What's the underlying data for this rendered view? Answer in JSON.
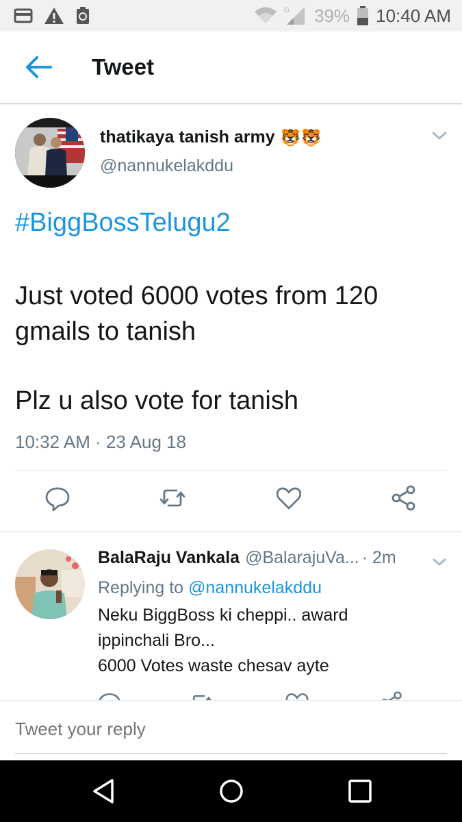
{
  "status_bar": {
    "battery": "39%",
    "time": "10:40 AM",
    "icons": [
      "card-icon",
      "warning-icon",
      "recycle-icon",
      "wifi-icon",
      "signal-icon",
      "battery-icon"
    ]
  },
  "app_bar": {
    "title": "Tweet",
    "back_icon": "arrow-left-icon"
  },
  "tweet": {
    "display_name": "thatikaya tanish army",
    "emoji": "🐯🐯",
    "handle": "@nannukelakddu",
    "hashtag": "#BiggBossTelugu2",
    "body_line1": "Just voted 6000 votes from 120 gmails to tanish",
    "body_line2": "Plz u also vote for tanish",
    "timestamp": "10:32 AM · 23 Aug 18",
    "actions": [
      "reply-icon",
      "retweet-icon",
      "like-icon",
      "share-icon"
    ]
  },
  "reply": {
    "display_name": "BalaRaju Vankala",
    "handle": "@BalarajuVa...",
    "time": "· 2m",
    "replying_prefix": "Replying to ",
    "replying_to": "@nannukelakddu",
    "text_line1": "Neku BiggBoss ki cheppi.. award",
    "text_line2": "ippinchali Bro...",
    "text_line3": "6000 Votes waste chesav ayte"
  },
  "compose": {
    "placeholder": "Tweet your reply"
  },
  "nav_bar": {
    "buttons": [
      "back-triangle-icon",
      "home-circle-icon",
      "recents-square-icon"
    ]
  },
  "colors": {
    "accent": "#1b95e0",
    "secondary_text": "#657786",
    "status_bar": "#f1f1f1"
  }
}
